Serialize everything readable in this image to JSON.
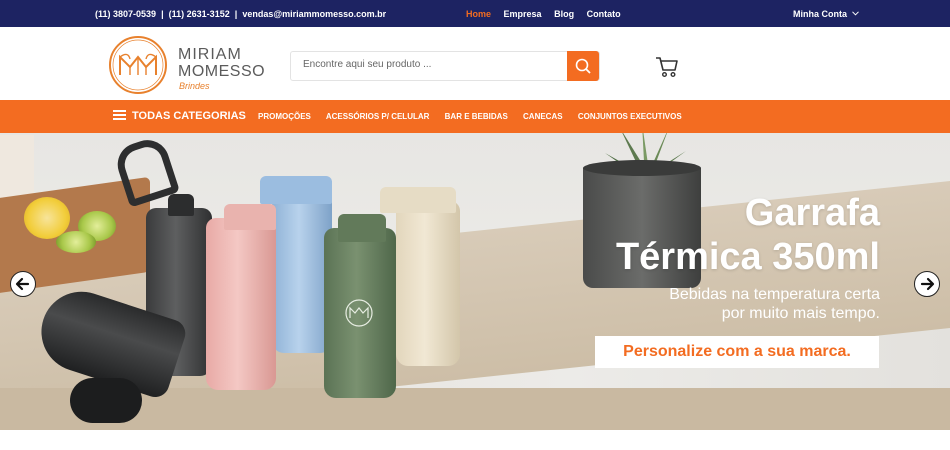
{
  "topbar": {
    "phone1": "(11) 3807-0539",
    "sep1": "|",
    "phone2": "(11) 2631-3152",
    "sep2": "|",
    "email": "vendas@miriammomesso.com.br",
    "nav": [
      "Home",
      "Empresa",
      "Blog",
      "Contato"
    ],
    "account": "Minha Conta"
  },
  "brand": {
    "line1": "MIRIAM",
    "line2": "MOMESSO",
    "tagline": "Brindes",
    "accent": "#f36c21",
    "navy": "#1d2362"
  },
  "search": {
    "placeholder": "Encontre aqui seu produto ..."
  },
  "icons": {
    "search": "search-icon",
    "cart": "cart-icon",
    "menu": "hamburger-icon",
    "prev": "arrow-left-icon",
    "next": "arrow-right-icon"
  },
  "categories": {
    "all_label": "TODAS CATEGORIAS",
    "items": [
      "PROMOÇÕES",
      "ACESSÓRIOS P/ CELULAR",
      "BAR E BEBIDAS",
      "CANECAS",
      "CONJUNTOS EXECUTIVOS"
    ]
  },
  "banner": {
    "title_line1": "Garrafa",
    "title_line2": "Térmica 350ml",
    "sub_line1": "Bebidas na temperatura certa",
    "sub_line2": "por muito mais tempo.",
    "cta": "Personalize com a sua marca."
  }
}
